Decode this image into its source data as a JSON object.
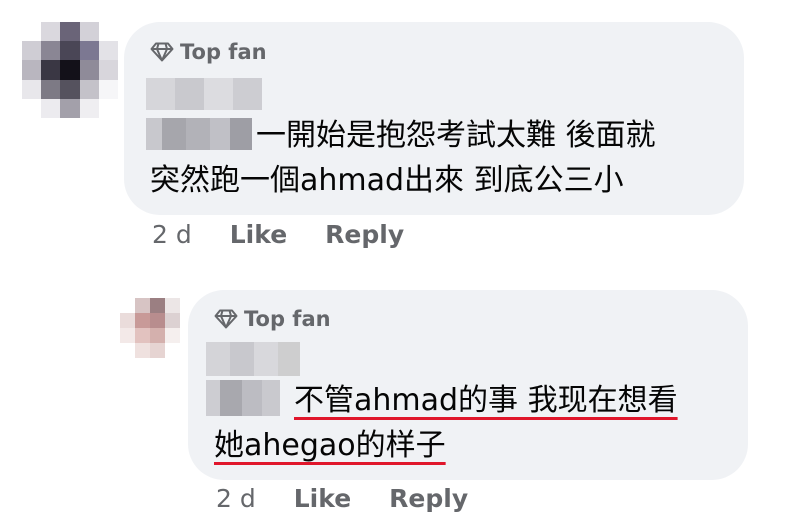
{
  "comments": [
    {
      "badge": "Top fan",
      "line1": "一開始是抱怨考試太難 後面就",
      "line2": "突然跑一個ahmad出來 到底公三小",
      "time": "2 d",
      "like_label": "Like",
      "reply_label": "Reply"
    },
    {
      "badge": "Top fan",
      "line1": "不管ahmad的事 我现在想看",
      "line2": "她ahegao的样子",
      "time": "2 d",
      "like_label": "Like",
      "reply_label": "Reply"
    }
  ],
  "colors": {
    "bubble": "#f0f2f5",
    "meta_text": "#65676b",
    "body_text": "#050505",
    "underline": "#e0162b"
  },
  "icons": {
    "badge_icon": "diamond-icon"
  }
}
